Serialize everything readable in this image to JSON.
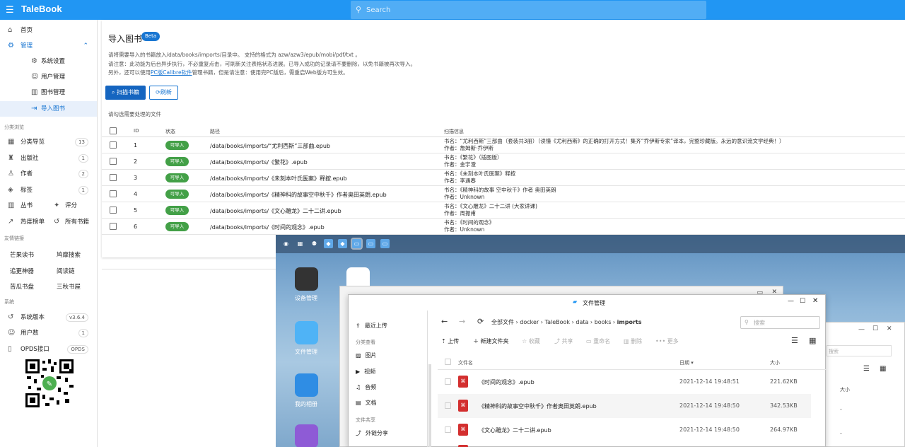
{
  "app": {
    "name": "TaleBook",
    "search_placeholder": "Search"
  },
  "sidebar": {
    "home": "首页",
    "manage": "管理",
    "sub": [
      "系统设置",
      "用户管理",
      "图书管理",
      "导入图书"
    ],
    "browse_section": "分类浏览",
    "browse": [
      {
        "label": "分类导览",
        "count": "13"
      },
      {
        "label": "出版社",
        "count": "1"
      },
      {
        "label": "作者",
        "count": "2"
      },
      {
        "label": "标签",
        "count": "1"
      }
    ],
    "series": "丛书",
    "rating": "评分",
    "hot": "热度榜单",
    "all_books": "所有书籍",
    "links_section": "友情链接",
    "links": [
      "芒果读书",
      "鸠摩搜索",
      "追更神器",
      "阅读链",
      "苦瓜书盘",
      "三秋书屋"
    ],
    "system_section": "系统",
    "system": [
      {
        "label": "系统版本",
        "count": "v3.6.4"
      },
      {
        "label": "用户数",
        "count": "1"
      },
      {
        "label": "OPDS接口",
        "count": "OPDS"
      }
    ]
  },
  "import": {
    "title": "导入图书",
    "badge": "Beta",
    "desc1": "请将需要导入的书籍放入/data/books/imports/目录中。 支持的格式为 azw/azw3/epub/mobi/pdf/txt 。",
    "desc2": "请注意：此功能为后台异步执行，不必重复点击，可刷新关注表格状态进展。已导入成功的记录请不要删除，以免书籍被再次导入。",
    "desc3_pre": "另外，还可以使用",
    "desc3_link": "PC版Calibre软件",
    "desc3_post": "管理书籍，但是请注意：使用完PC版后，需重启Web版方可生效。",
    "scan_button": "扫描书籍",
    "refresh_button": "刷新",
    "hint": "请勾选需要处理的文件",
    "columns": [
      "ID",
      "状态",
      "路径",
      "扫描信息"
    ],
    "rows": [
      {
        "id": "1",
        "status": "可导入",
        "path": "/data/books/imports/“尤利西斯”三部曲.epub",
        "info1": "书名：“尤利西斯”三部曲（套装共3册）（读懂《尤利西斯》的正确的打开方式！集齐“乔伊斯专家”译本，完整珍藏版。永远的意识流文学经典！）",
        "info2": "作者：詹姆斯·乔伊斯"
      },
      {
        "id": "2",
        "status": "可导入",
        "path": "/data/books/imports/《繁花》.epub",
        "info1": "书名：《繁花》（插图版）",
        "info2": "作者：金宇澄"
      },
      {
        "id": "3",
        "status": "可导入",
        "path": "/data/books/imports/《未刻本叶氏医案》释按.epub",
        "info1": "书名：《未刻本叶氏医案》释按",
        "info2": "作者：李遇春"
      },
      {
        "id": "4",
        "status": "可导入",
        "path": "/data/books/imports/《精神科的故事空中秋千》作者奥田英朗.epub",
        "info1": "书名：《精神科的故事 空中秋千》作者 奥田英朗",
        "info2": "作者：Unknown"
      },
      {
        "id": "5",
        "status": "可导入",
        "path": "/data/books/imports/《文心雕龙》二十二讲.epub",
        "info1": "书名：《文心雕龙》二十二讲 (大家讲课)",
        "info2": "作者：周振甫"
      },
      {
        "id": "6",
        "status": "可导入",
        "path": "/data/books/imports/《时间的观念》.epub",
        "info1": "书名：《时间的观念》",
        "info2": "作者：Unknown"
      }
    ]
  },
  "desktop": {
    "icons": [
      "设备管理",
      "文件管理",
      "我的相册"
    ],
    "fm": {
      "title": "文件管理",
      "sidebar_top": [
        "最近上传"
      ],
      "cat_section": "分类查看",
      "cats": [
        "图片",
        "视频",
        "音频",
        "文档"
      ],
      "share_section": "文件共享",
      "share": [
        "外链分享"
      ],
      "breadcrumb": [
        "全部文件",
        "docker",
        "TaleBook",
        "data",
        "books",
        "imports"
      ],
      "search_placeholder": "搜索",
      "toolbar": [
        "上传",
        "新建文件夹",
        "收藏",
        "共享",
        "重命名",
        "删除",
        "更多"
      ],
      "columns": [
        "文件名",
        "日期",
        "大小"
      ],
      "files": [
        {
          "name": "《时间的观念》.epub",
          "date": "2021-12-14 19:48:51",
          "size": "221.62KB"
        },
        {
          "name": "《精神科的故事空中秋千》作者奥田英朗.epub",
          "date": "2021-12-14 19:48:50",
          "size": "342.53KB"
        },
        {
          "name": "《文心雕龙》二十二讲.epub",
          "date": "2021-12-14 19:48:50",
          "size": "264.97KB"
        }
      ],
      "back_window_size_col": "大小",
      "back_window_search": "搜索"
    }
  }
}
